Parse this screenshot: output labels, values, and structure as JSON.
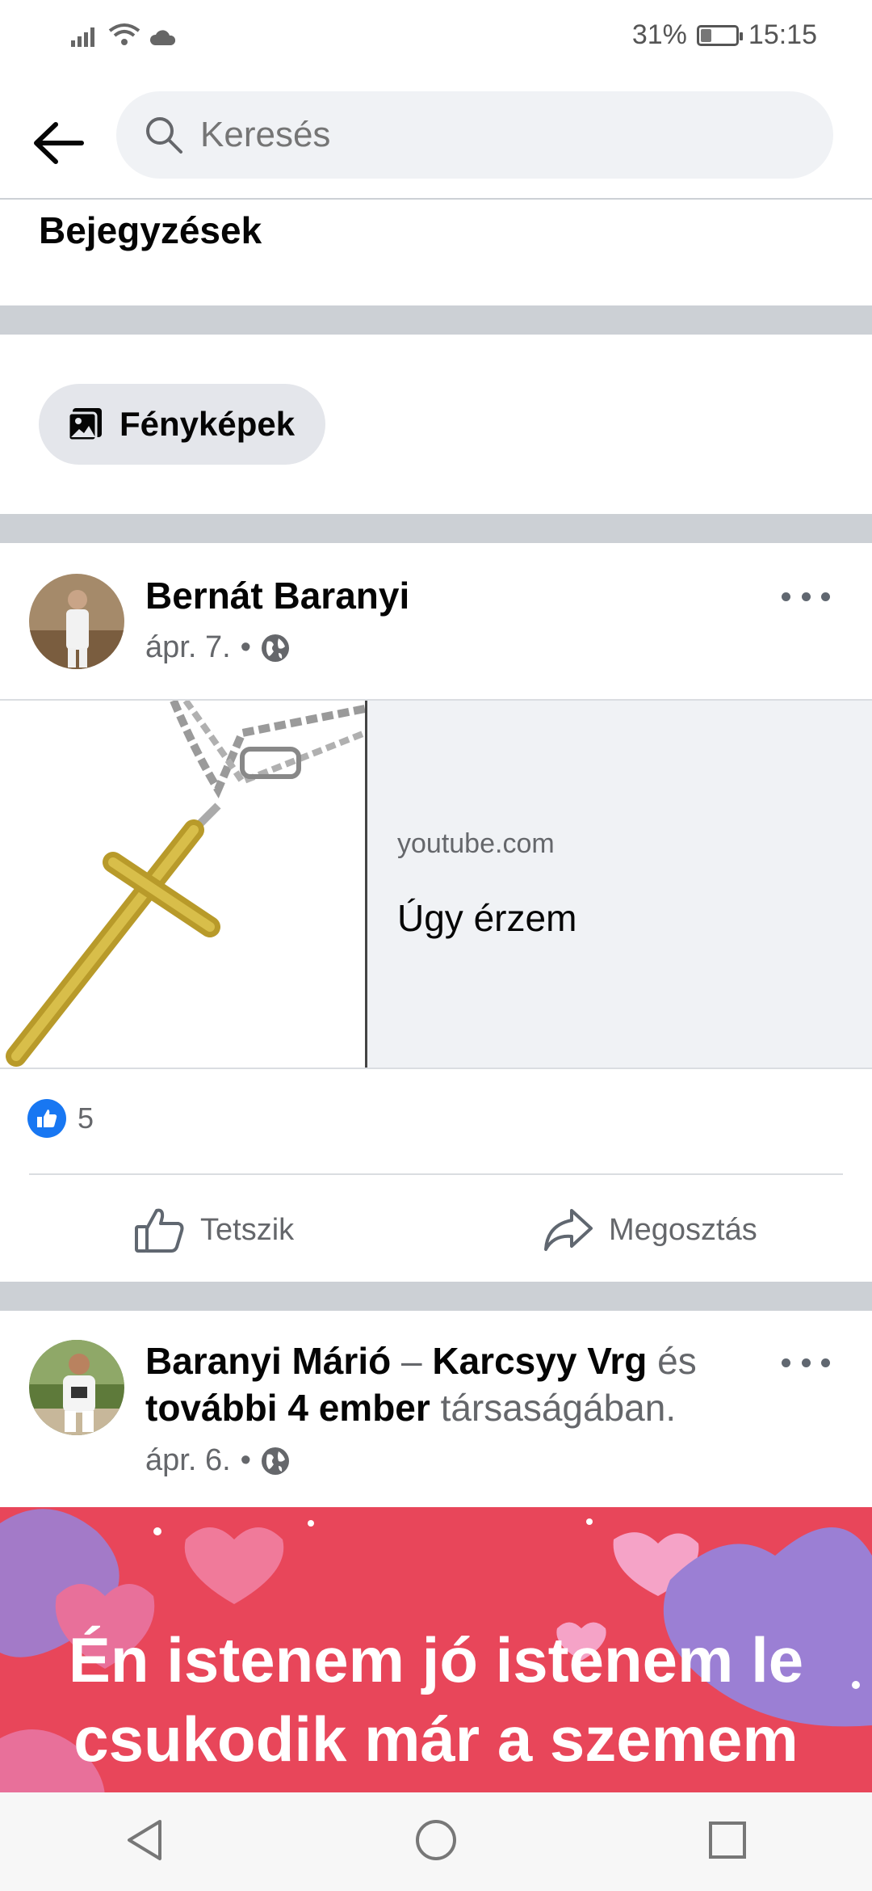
{
  "status": {
    "battery": "31%",
    "time": "15:15",
    "battery_level": 0.31
  },
  "header": {
    "search_placeholder": "Keresés"
  },
  "section": {
    "title": "Bejegyzések"
  },
  "filters": {
    "photos_label": "Fényképek"
  },
  "post1": {
    "author": "Bernát Baranyi",
    "date": "ápr. 7.",
    "dot": "•",
    "link": {
      "domain": "youtube.com",
      "title": "Úgy érzem"
    },
    "reaction_count": "5",
    "like_label": "Tetszik",
    "share_label": "Megosztás"
  },
  "post2": {
    "author": "Baranyi Márió",
    "dash": "–",
    "tagged": "Karcsyy Vrg",
    "and": "és",
    "others": "további 4 ember",
    "suffix": "társaságában.",
    "date": "ápr. 6.",
    "dot": "•",
    "banner_line1": "Én istenem jó istenem le",
    "banner_line2": "csukodik már a szemem"
  },
  "colors": {
    "accent": "#1877f2",
    "banner": "#e8465a",
    "divider": "#ccd0d5"
  }
}
